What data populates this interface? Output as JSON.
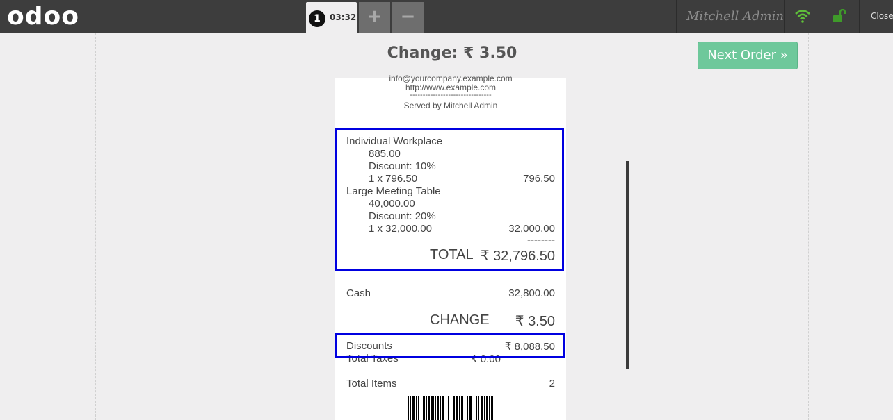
{
  "header": {
    "logo": "odoo",
    "order_number": "1",
    "order_time": "03:32",
    "add_label": "+",
    "remove_label": "−",
    "user": "Mitchell Admin",
    "close_label": "Close"
  },
  "screen": {
    "change_title": "Change: ₹ 3.50",
    "next_order_label": "Next Order »"
  },
  "receipt": {
    "email": "info@yourcompany.example.com",
    "website": "http://www.example.com",
    "separator": "--------------------------------",
    "served_by": "Served by Mitchell Admin",
    "lines": [
      {
        "name": "Individual Workplace",
        "unit_price": "885.00",
        "discount": "Discount: 10%",
        "qty_line": "1 x 796.50",
        "total": "796.50"
      },
      {
        "name": "Large Meeting Table",
        "unit_price": "40,000.00",
        "discount": "Discount: 20%",
        "qty_line": "1 x 32,000.00",
        "total": "32,000.00"
      }
    ],
    "dashes": "--------",
    "total_label": "TOTAL",
    "total_value": "₹ 32,796.50",
    "payment_label": "Cash",
    "payment_value": "32,800.00",
    "change_label": "CHANGE",
    "change_value": "₹ 3.50",
    "discounts_label": "Discounts",
    "discounts_value": "₹ 8,088.50",
    "taxes_label": "Total Taxes",
    "taxes_value": "₹ 0.00",
    "items_label": "Total Items",
    "items_value": "2"
  },
  "colors": {
    "topbar": "#3d3d3d",
    "accent_green": "#6ec89b",
    "highlight_blue": "#0000e0",
    "wifi_green": "#5fbf3a"
  }
}
